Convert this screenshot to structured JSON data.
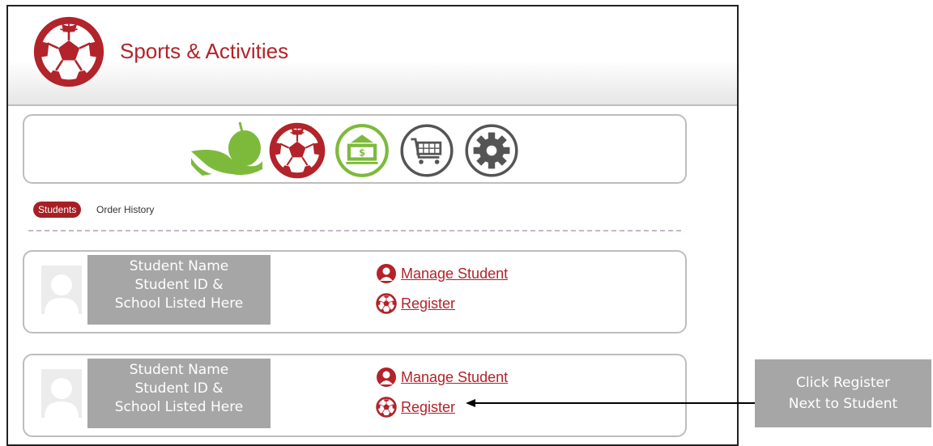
{
  "header": {
    "title": "Sports & Activities",
    "logo_icon": "soccer-ball-icon"
  },
  "nav_icons": [
    {
      "name": "apple-hand-icon",
      "color": "#7dba3b"
    },
    {
      "name": "soccer-ball-icon",
      "color": "#b2232a"
    },
    {
      "name": "money-icon",
      "color": "#7dba3b"
    },
    {
      "name": "shopping-cart-icon",
      "color": "#555555"
    },
    {
      "name": "gear-icon",
      "color": "#555555"
    }
  ],
  "tabs": {
    "active": "Students",
    "other": "Order History"
  },
  "students": [
    {
      "info_lines": [
        "Student Name",
        "Student ID &",
        "School Listed Here"
      ],
      "manage_label": "Manage Student",
      "register_label": "Register"
    },
    {
      "info_lines": [
        "Student Name",
        "Student ID &",
        "School Listed Here"
      ],
      "manage_label": "Manage Student",
      "register_label": "Register"
    }
  ],
  "callout": {
    "lines": [
      "Click Register",
      "Next to Student"
    ]
  },
  "colors": {
    "brand_red": "#b2232a",
    "tab_active_bg": "#a61f24",
    "green": "#7dba3b",
    "gray_icon": "#555555",
    "placeholder_gray": "#a6a6a6"
  }
}
